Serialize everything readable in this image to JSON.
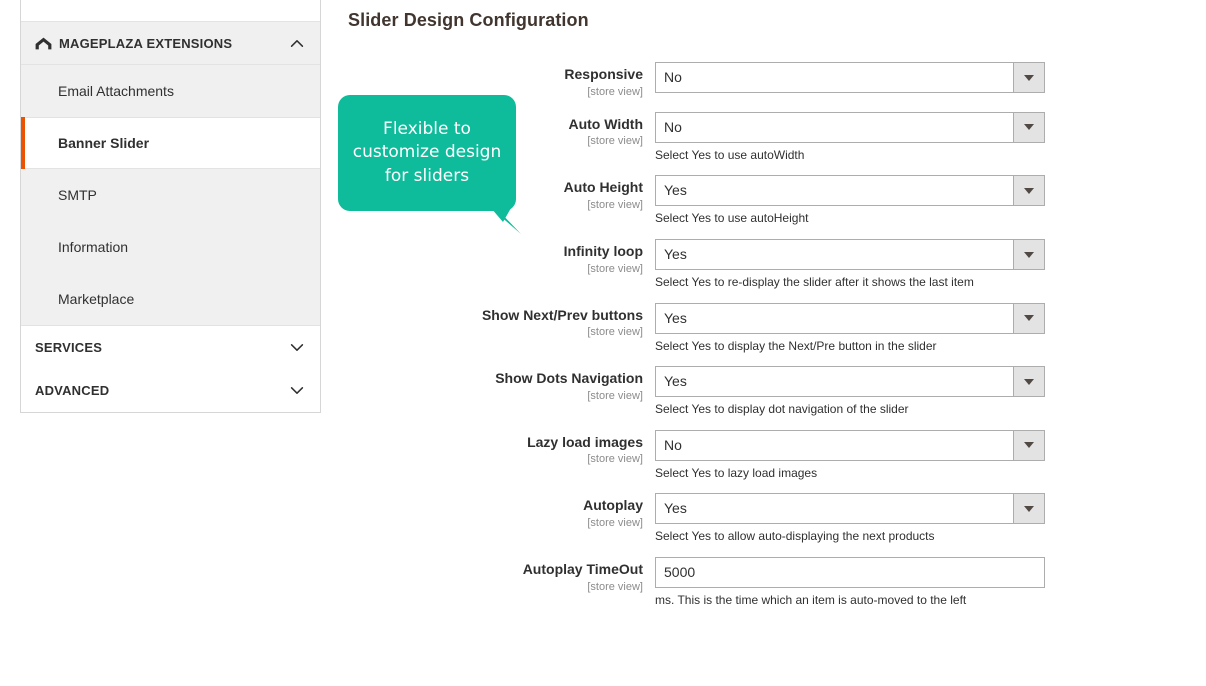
{
  "sidebar": {
    "sections": [
      {
        "id": "mageplaza-extensions",
        "label": "MAGEPLAZA EXTENSIONS",
        "expanded": true,
        "icon": "mageplaza-arch-logo-icon",
        "chevron": "chevron-up-icon",
        "items": [
          {
            "label": "Email Attachments",
            "active": false
          },
          {
            "label": "Banner Slider",
            "active": true
          },
          {
            "label": "SMTP",
            "active": false
          },
          {
            "label": "Information",
            "active": false
          },
          {
            "label": "Marketplace",
            "active": false
          }
        ]
      },
      {
        "id": "services",
        "label": "SERVICES",
        "expanded": false,
        "chevron": "chevron-down-icon",
        "items": []
      },
      {
        "id": "advanced",
        "label": "ADVANCED",
        "expanded": false,
        "chevron": "chevron-down-icon",
        "items": []
      }
    ],
    "active_accent_color": "#eb5202",
    "item_bg_color": "#f0f0f0"
  },
  "main": {
    "title": "Slider Design Configuration",
    "callout": {
      "text": "Flexible to customize design for sliders",
      "color": "#0ebb9a",
      "text_color": "#ffffff"
    },
    "scope_label": "[store view]",
    "fields": [
      {
        "label": "Responsive",
        "scope": "[store view]",
        "type": "select",
        "value": "No",
        "options": [
          "Yes",
          "No"
        ],
        "note": ""
      },
      {
        "label": "Auto Width",
        "scope": "[store view]",
        "type": "select",
        "value": "No",
        "options": [
          "Yes",
          "No"
        ],
        "note": "Select Yes to use autoWidth"
      },
      {
        "label": "Auto Height",
        "scope": "[store view]",
        "type": "select",
        "value": "Yes",
        "options": [
          "Yes",
          "No"
        ],
        "note": "Select Yes to use autoHeight"
      },
      {
        "label": "Infinity loop",
        "scope": "[store view]",
        "type": "select",
        "value": "Yes",
        "options": [
          "Yes",
          "No"
        ],
        "note": "Select Yes to re-display the slider after it shows the last item"
      },
      {
        "label": "Show Next/Prev buttons",
        "scope": "[store view]",
        "type": "select",
        "value": "Yes",
        "options": [
          "Yes",
          "No"
        ],
        "note": "Select Yes to display the Next/Pre button in the slider"
      },
      {
        "label": "Show Dots Navigation",
        "scope": "[store view]",
        "type": "select",
        "value": "Yes",
        "options": [
          "Yes",
          "No"
        ],
        "note": "Select Yes to display dot navigation of the slider"
      },
      {
        "label": "Lazy load images",
        "scope": "[store view]",
        "type": "select",
        "value": "No",
        "options": [
          "Yes",
          "No"
        ],
        "note": "Select Yes to lazy load images"
      },
      {
        "label": "Autoplay",
        "scope": "[store view]",
        "type": "select",
        "value": "Yes",
        "options": [
          "Yes",
          "No"
        ],
        "note": "Select Yes to allow auto-displaying the next products"
      },
      {
        "label": "Autoplay TimeOut",
        "scope": "[store view]",
        "type": "text",
        "value": "5000",
        "note": "ms. This is the time which an item is auto-moved to the left"
      }
    ]
  }
}
